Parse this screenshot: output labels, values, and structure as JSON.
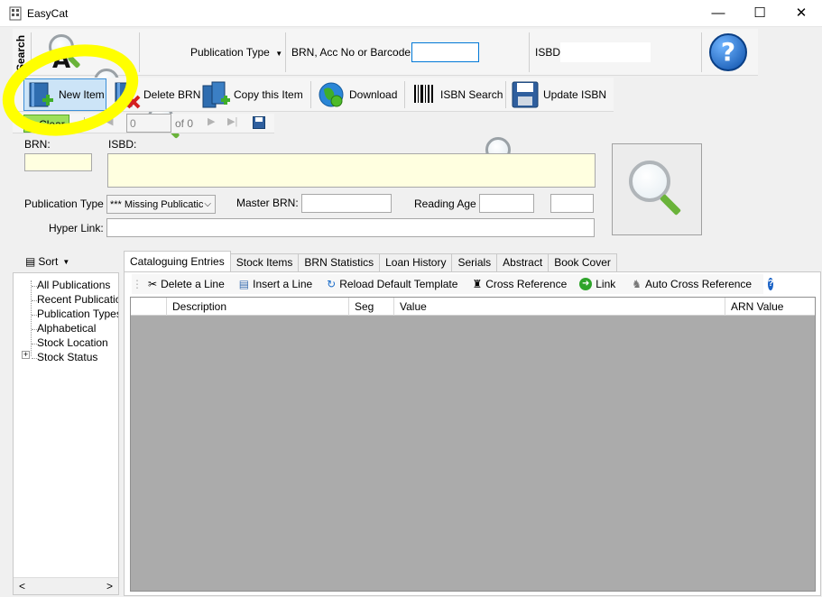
{
  "window": {
    "title": "EasyCat",
    "minimize": "—",
    "maximize": "☐",
    "close": "✕"
  },
  "search_toolbar": {
    "group_label": "Search",
    "publication_type_label": "Publication Type",
    "brn_label": "BRN, Acc No or Barcode",
    "brn_value": "",
    "isbd_label": "ISBD",
    "isbd_value": "",
    "help_glyph": "?"
  },
  "main_toolbar": {
    "new_item": "New Item",
    "delete_brn": "Delete BRN",
    "copy_item": "Copy this Item",
    "download": "Download",
    "isbn_search": "ISBN Search",
    "update_isbn": "Update  ISBN"
  },
  "nav_toolbar": {
    "clear": "Clear",
    "position_value": "0",
    "of_label": "of 0"
  },
  "form": {
    "brn_label": "BRN:",
    "brn_value": "",
    "isbd_label": "ISBD:",
    "isbd_value": "",
    "publication_type_label": "Publication Type",
    "publication_type_value": "*** Missing Publicatic",
    "master_brn_label": "Master BRN:",
    "master_brn_value": "",
    "reading_age_label": "Reading Age",
    "reading_age_from": "",
    "reading_age_to": "",
    "hyper_link_label": "Hyper Link:",
    "hyper_link_value": ""
  },
  "sidebar": {
    "sort_label": "Sort",
    "items": [
      {
        "label": "All Publications"
      },
      {
        "label": "Recent Publication"
      },
      {
        "label": "Publication Types"
      },
      {
        "label": "Alphabetical"
      },
      {
        "label": "Stock Location"
      },
      {
        "label": "Stock Status"
      }
    ]
  },
  "tabs": [
    {
      "label": "Cataloguing Entries"
    },
    {
      "label": "Stock Items"
    },
    {
      "label": "BRN Statistics"
    },
    {
      "label": "Loan History"
    },
    {
      "label": "Serials"
    },
    {
      "label": "Abstract"
    },
    {
      "label": "Book Cover"
    }
  ],
  "entries_toolbar": {
    "delete_line": "Delete a Line",
    "insert_line": "Insert a Line",
    "reload_template": "Reload Default Template",
    "cross_reference": "Cross Reference",
    "link": "Link",
    "auto_cross_reference": "Auto Cross Reference"
  },
  "grid": {
    "columns": [
      "Description",
      "Seg",
      "Value",
      "ARN Value"
    ]
  },
  "colors": {
    "highlight_yellow": "#ffff00",
    "field_yellow": "#ffffe0",
    "grid_gray": "#ababab",
    "accent_blue": "#0078d7"
  }
}
